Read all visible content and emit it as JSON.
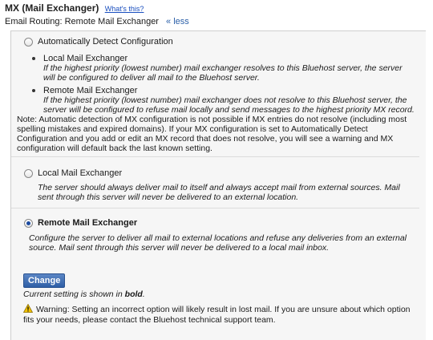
{
  "header": {
    "title": "MX (Mail Exchanger)",
    "whats_this": "What's this?",
    "routing_label": "Email Routing: Remote Mail Exchanger",
    "less_link": "« less"
  },
  "options": {
    "auto": {
      "label": "Automatically Detect Configuration",
      "bullets": [
        {
          "title": "Local Mail Exchanger",
          "desc": "If the highest priority (lowest number) mail exchanger resolves to this Bluehost server, the server will be configured to deliver all mail to the Bluehost server."
        },
        {
          "title": "Remote Mail Exchanger",
          "desc": "If the highest priority (lowest number) mail exchanger does not resolve to this Bluehost server, the server will be configured to refuse mail locally and send messages to the highest priority MX record."
        }
      ],
      "note": "Note: Automatic detection of MX configuration is not possible if MX entries do not resolve (including most spelling mistakes and expired domains). If your MX configuration is set to Automatically Detect Configuration and you add or edit an MX record that does not resolve, you will see a warning and MX configuration will default back the last known setting."
    },
    "local": {
      "label": "Local Mail Exchanger",
      "desc": "The server should always deliver mail to itself and always accept mail from external sources. Mail sent through this server will never be delivered to an external location."
    },
    "remote": {
      "label": "Remote Mail Exchanger",
      "desc": "Configure the server to deliver all mail to external locations and refuse any deliveries from an external source. Mail sent through this server will never be delivered to a local mail inbox."
    }
  },
  "change_button": "Change",
  "current_setting": {
    "prefix": "Current setting is shown in ",
    "bold": "bold",
    "suffix": "."
  },
  "warning": "Warning: Setting an incorrect option will likely result in lost mail. If you are unsure about which option fits your needs, please contact the Bluehost technical support team.",
  "colors": {
    "accent": "#2f5fa6",
    "link": "#1a4fbf",
    "panel_bg": "#f6f6f6",
    "warning_icon": "#f2c200"
  }
}
